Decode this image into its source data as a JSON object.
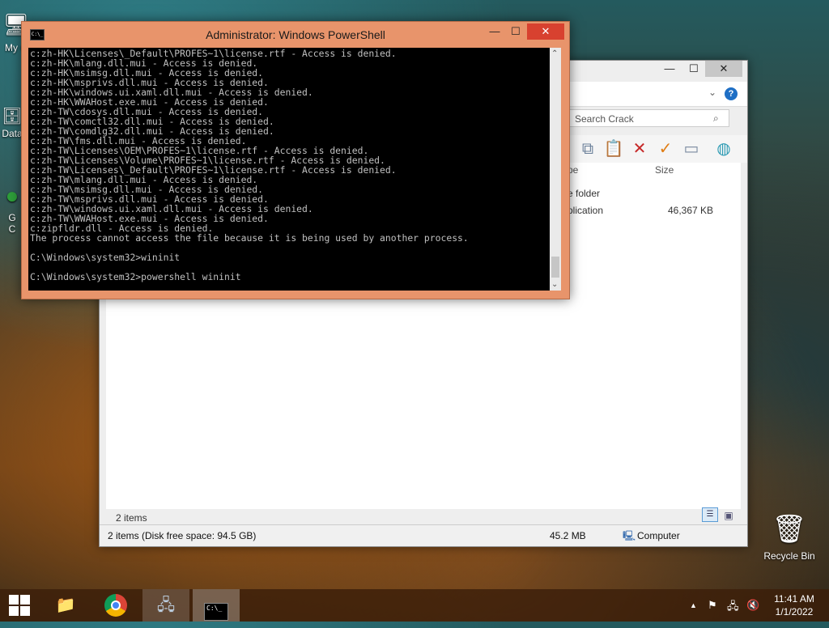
{
  "desktop": {
    "icons": [
      {
        "label": "My C",
        "glyph": "🖥"
      },
      {
        "label": "Data",
        "glyph": "🗄"
      },
      {
        "label": "G\nC",
        "glyph": "●"
      },
      {
        "label": "Recycle Bin",
        "glyph": "🗑"
      }
    ]
  },
  "powershell": {
    "title": "Administrator: Windows PowerShell",
    "lines": [
      "c:zh-HK\\Licenses\\_Default\\PROFES~1\\license.rtf - Access is denied.",
      "c:zh-HK\\mlang.dll.mui - Access is denied.",
      "c:zh-HK\\msimsg.dll.mui - Access is denied.",
      "c:zh-HK\\msprivs.dll.mui - Access is denied.",
      "c:zh-HK\\windows.ui.xaml.dll.mui - Access is denied.",
      "c:zh-HK\\WWAHost.exe.mui - Access is denied.",
      "c:zh-TW\\cdosys.dll.mui - Access is denied.",
      "c:zh-TW\\comctl32.dll.mui - Access is denied.",
      "c:zh-TW\\comdlg32.dll.mui - Access is denied.",
      "c:zh-TW\\fms.dll.mui - Access is denied.",
      "c:zh-TW\\Licenses\\OEM\\PROFES~1\\license.rtf - Access is denied.",
      "c:zh-TW\\Licenses\\Volume\\PROFES~1\\license.rtf - Access is denied.",
      "c:zh-TW\\Licenses\\_Default\\PROFES~1\\license.rtf - Access is denied.",
      "c:zh-TW\\mlang.dll.mui - Access is denied.",
      "c:zh-TW\\msimsg.dll.mui - Access is denied.",
      "c:zh-TW\\msprivs.dll.mui - Access is denied.",
      "c:zh-TW\\windows.ui.xaml.dll.mui - Access is denied.",
      "c:zh-TW\\WWAHost.exe.mui - Access is denied.",
      "c:zipfldr.dll - Access is denied.",
      "The process cannot access the file because it is being used by another process.",
      "",
      "C:\\Windows\\system32>wininit",
      "",
      "C:\\Windows\\system32>powershell wininit"
    ],
    "cursor": "_",
    "icon_label": "C:\\_",
    "buttons": {
      "minimize": "—",
      "maximize": "☐",
      "close": "✕"
    }
  },
  "explorer": {
    "buttons": {
      "minimize": "—",
      "maximize": "☐",
      "close": "✕"
    },
    "help": "?",
    "search_placeholder": "Search Crack",
    "columns": [
      "pe",
      "Size"
    ],
    "rows": [
      {
        "type": "e folder",
        "size": ""
      },
      {
        "type": "plication",
        "size": "46,367 KB"
      }
    ],
    "items_count": "2 items",
    "status": {
      "left": "2 items (Disk free space: 94.5 GB)",
      "size": "45.2 MB",
      "location": "Computer"
    }
  },
  "taskbar": {
    "start_icon": "start-icon",
    "apps": [
      {
        "name": "file-explorer",
        "glyph": "📁"
      },
      {
        "name": "chrome",
        "glyph": "◉"
      },
      {
        "name": "network-setup",
        "glyph": "🖧"
      },
      {
        "name": "powershell",
        "glyph": "C:\\_"
      }
    ],
    "clock_time": "11:41 AM",
    "clock_date": "1/1/2022",
    "tray_arrow": "▲"
  },
  "colors": {
    "powershell_frame": "#e8946b",
    "close_red": "#d8412f",
    "console_bg": "#000000",
    "console_text": "#c0c0c0"
  }
}
